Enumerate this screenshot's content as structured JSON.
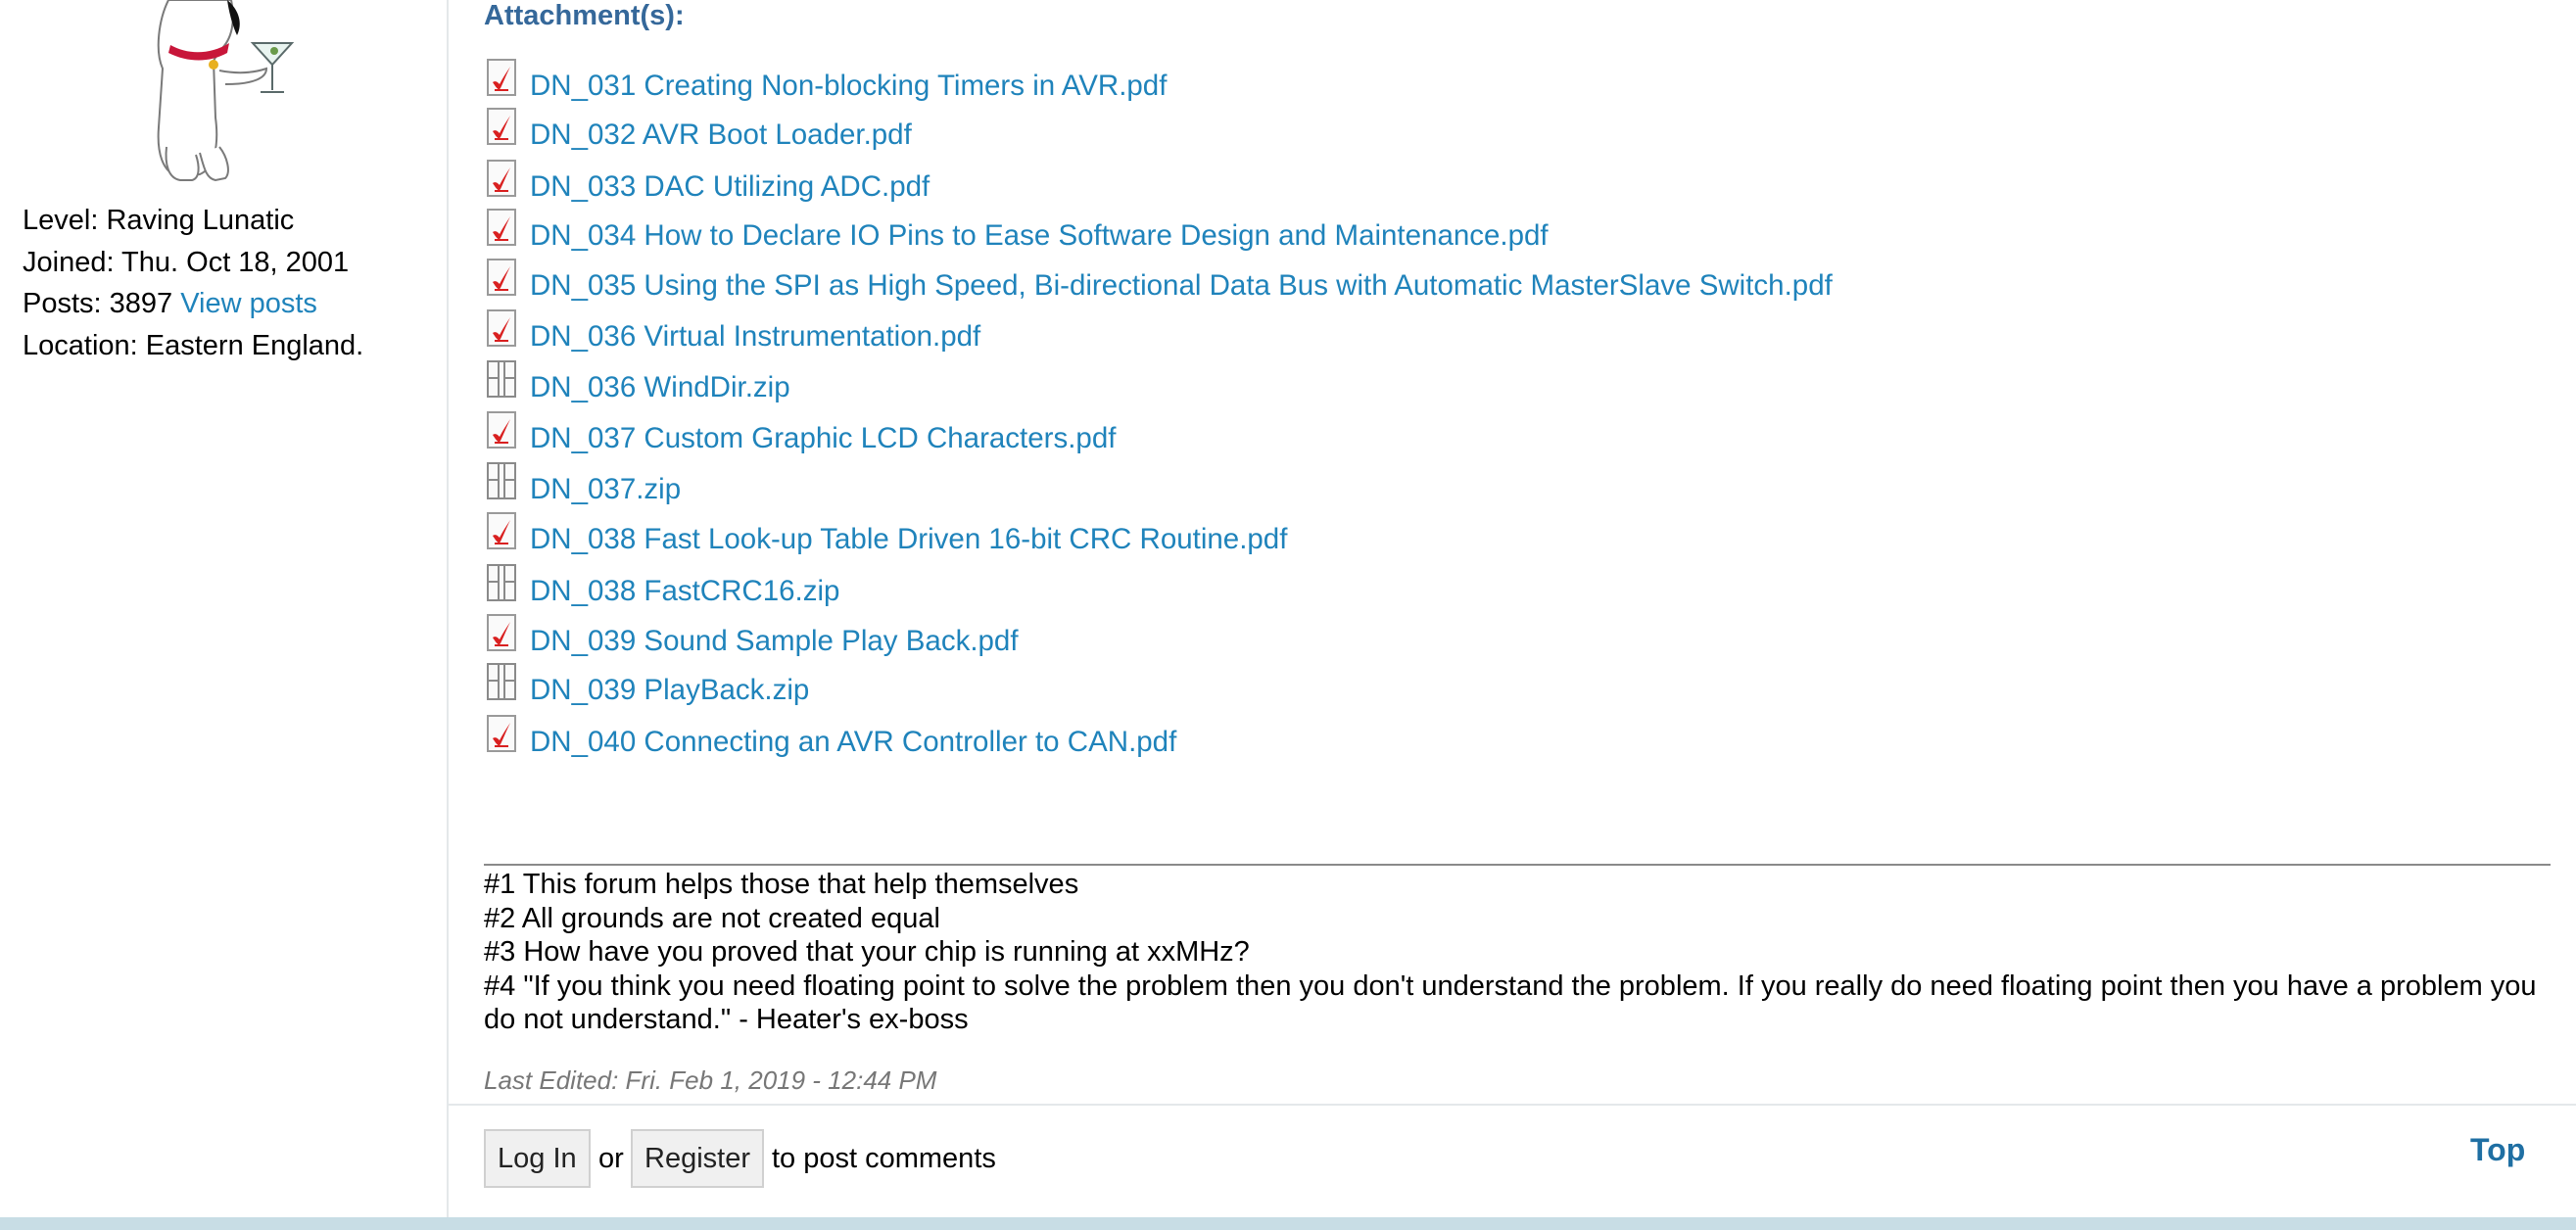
{
  "user": {
    "level": "Level: Raving Lunatic",
    "joined": "Joined: Thu. Oct 18, 2001",
    "posts_prefix": "Posts: 3897",
    "view_posts": "View posts",
    "location": "Location: Eastern England."
  },
  "attachments": {
    "title": "Attachment(s):",
    "items": [
      {
        "name": "DN_031 Creating Non-blocking Timers in AVR.pdf",
        "icon": "pdf-icon"
      },
      {
        "name": "DN_032 AVR Boot Loader.pdf",
        "icon": "pdf-icon"
      },
      {
        "name": "DN_033 DAC Utilizing ADC.pdf",
        "icon": "pdf-icon"
      },
      {
        "name": "DN_034 How to Declare IO Pins to Ease Software Design and Maintenance.pdf",
        "icon": "pdf-icon"
      },
      {
        "name": "DN_035 Using the SPI as High Speed, Bi-directional Data Bus with Automatic MasterSlave Switch.pdf",
        "icon": "pdf-icon"
      },
      {
        "name": "DN_036 Virtual Instrumentation.pdf",
        "icon": "pdf-icon"
      },
      {
        "name": "DN_036 WindDir.zip",
        "icon": "zip-icon"
      },
      {
        "name": "DN_037 Custom Graphic LCD Characters.pdf",
        "icon": "pdf-icon"
      },
      {
        "name": "DN_037.zip",
        "icon": "zip-icon"
      },
      {
        "name": "DN_038 Fast Look-up Table Driven 16-bit CRC Routine.pdf",
        "icon": "pdf-icon"
      },
      {
        "name": "DN_038 FastCRC16.zip",
        "icon": "zip-icon"
      },
      {
        "name": "DN_039 Sound Sample Play Back.pdf",
        "icon": "pdf-icon"
      },
      {
        "name": "DN_039 PlayBack.zip",
        "icon": "zip-icon"
      },
      {
        "name": "DN_040 Connecting an AVR Controller to CAN.pdf",
        "icon": "pdf-icon"
      }
    ]
  },
  "signature": {
    "line1": "#1 This forum helps those that help themselves",
    "line2": "#2 All grounds are not created equal",
    "line3": "#3 How have you proved that your chip is running at xxMHz?",
    "line4": "#4 \"If you think you need floating point to solve the problem then you don't understand the problem. If you really do need floating point then you have a problem you do not understand.\" - Heater's ex-boss"
  },
  "last_edited": "Last Edited: Fri. Feb 1, 2019 - 12:44 PM",
  "footer": {
    "login": "Log In",
    "or": "or",
    "register": "Register",
    "suffix": "to post comments",
    "top": "Top"
  },
  "colors": {
    "link": "#1f83bb",
    "attachment_title": "#35689a",
    "top_link": "#1f6fa3",
    "bottom_bar": "#c8dde5"
  }
}
